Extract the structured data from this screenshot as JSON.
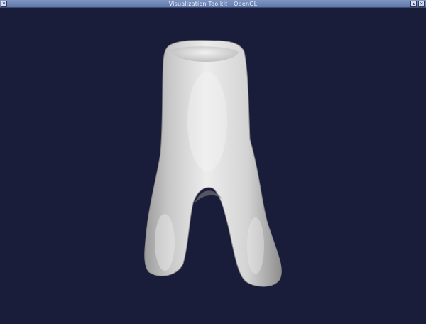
{
  "window": {
    "title": "Visualization Toolkit - OpenGL",
    "controls": {
      "menu_icon": "window-menu-icon",
      "maximize_icon": "maximize-icon",
      "close_icon": "close-icon"
    }
  },
  "viewport": {
    "background_color": "#1a1d3a",
    "object": "tooth-3d-surface",
    "surface_color": "#d9d9d9"
  }
}
